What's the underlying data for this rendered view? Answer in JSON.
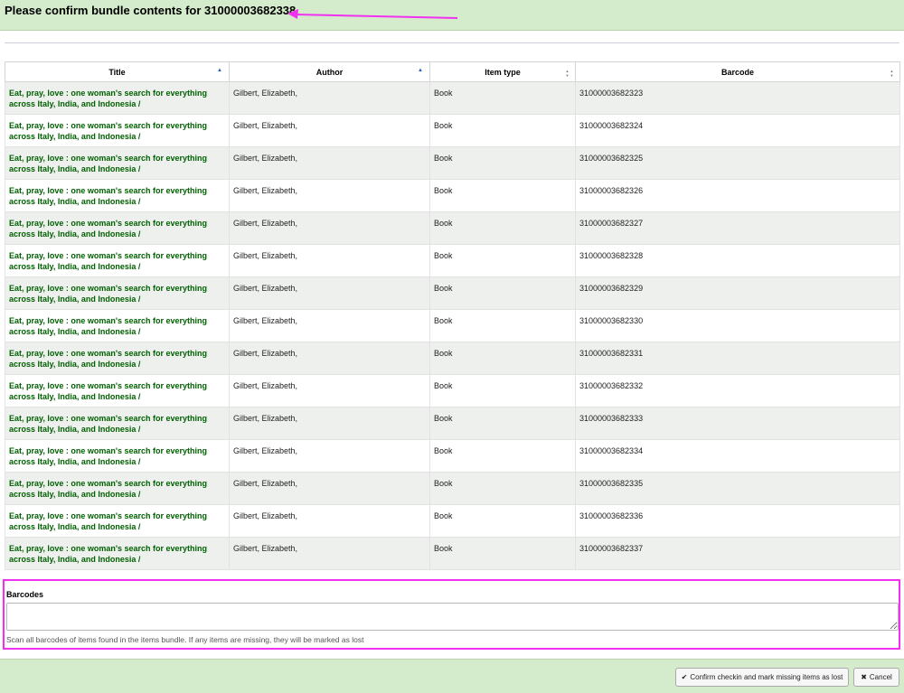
{
  "header": {
    "title": "Please confirm bundle contents for 31000003682338"
  },
  "table": {
    "columns": [
      {
        "label": "Title",
        "sort": "asc"
      },
      {
        "label": "Author",
        "sort": "asc"
      },
      {
        "label": "Item type",
        "sort": "both"
      },
      {
        "label": "Barcode",
        "sort": "both"
      }
    ],
    "rows": [
      {
        "title_line1": "Eat, pray, love : one woman's search for everything",
        "title_line2": "across Italy, India, and Indonesia /",
        "author": "Gilbert, Elizabeth,",
        "itemtype": "Book",
        "barcode": "31000003682323"
      },
      {
        "title_line1": "Eat, pray, love : one woman's search for everything",
        "title_line2": "across Italy, India, and Indonesia /",
        "author": "Gilbert, Elizabeth,",
        "itemtype": "Book",
        "barcode": "31000003682324"
      },
      {
        "title_line1": "Eat, pray, love : one woman's search for everything",
        "title_line2": "across Italy, India, and Indonesia /",
        "author": "Gilbert, Elizabeth,",
        "itemtype": "Book",
        "barcode": "31000003682325"
      },
      {
        "title_line1": "Eat, pray, love : one woman's search for everything",
        "title_line2": "across Italy, India, and Indonesia /",
        "author": "Gilbert, Elizabeth,",
        "itemtype": "Book",
        "barcode": "31000003682326"
      },
      {
        "title_line1": "Eat, pray, love : one woman's search for everything",
        "title_line2": "across Italy, India, and Indonesia /",
        "author": "Gilbert, Elizabeth,",
        "itemtype": "Book",
        "barcode": "31000003682327"
      },
      {
        "title_line1": "Eat, pray, love : one woman's search for everything",
        "title_line2": "across Italy, India, and Indonesia /",
        "author": "Gilbert, Elizabeth,",
        "itemtype": "Book",
        "barcode": "31000003682328"
      },
      {
        "title_line1": "Eat, pray, love : one woman's search for everything",
        "title_line2": "across Italy, India, and Indonesia /",
        "author": "Gilbert, Elizabeth,",
        "itemtype": "Book",
        "barcode": "31000003682329"
      },
      {
        "title_line1": "Eat, pray, love : one woman's search for everything",
        "title_line2": "across Italy, India, and Indonesia /",
        "author": "Gilbert, Elizabeth,",
        "itemtype": "Book",
        "barcode": "31000003682330"
      },
      {
        "title_line1": "Eat, pray, love : one woman's search for everything",
        "title_line2": "across Italy, India, and Indonesia /",
        "author": "Gilbert, Elizabeth,",
        "itemtype": "Book",
        "barcode": "31000003682331"
      },
      {
        "title_line1": "Eat, pray, love : one woman's search for everything",
        "title_line2": "across Italy, India, and Indonesia /",
        "author": "Gilbert, Elizabeth,",
        "itemtype": "Book",
        "barcode": "31000003682332"
      },
      {
        "title_line1": "Eat, pray, love : one woman's search for everything",
        "title_line2": "across Italy, India, and Indonesia /",
        "author": "Gilbert, Elizabeth,",
        "itemtype": "Book",
        "barcode": "31000003682333"
      },
      {
        "title_line1": "Eat, pray, love : one woman's search for everything",
        "title_line2": "across Italy, India, and Indonesia /",
        "author": "Gilbert, Elizabeth,",
        "itemtype": "Book",
        "barcode": "31000003682334"
      },
      {
        "title_line1": "Eat, pray, love : one woman's search for everything",
        "title_line2": "across Italy, India, and Indonesia /",
        "author": "Gilbert, Elizabeth,",
        "itemtype": "Book",
        "barcode": "31000003682335"
      },
      {
        "title_line1": "Eat, pray, love : one woman's search for everything",
        "title_line2": "across Italy, India, and Indonesia /",
        "author": "Gilbert, Elizabeth,",
        "itemtype": "Book",
        "barcode": "31000003682336"
      },
      {
        "title_line1": "Eat, pray, love : one woman's search for everything",
        "title_line2": "across Italy, India, and Indonesia /",
        "author": "Gilbert, Elizabeth,",
        "itemtype": "Book",
        "barcode": "31000003682337"
      }
    ]
  },
  "barcodes": {
    "label": "Barcodes",
    "value": "",
    "hint": "Scan all barcodes of items found in the items bundle. If any items are missing, they will be marked as lost"
  },
  "footer": {
    "confirm_label": "Confirm checkin and mark missing items as lost",
    "cancel_label": "Cancel",
    "confirm_icon": "check-icon",
    "cancel_icon": "close-icon"
  },
  "colors": {
    "header_bg": "#d4ebcc",
    "title_link": "#006100",
    "annotation_highlight": "#f032f0"
  }
}
